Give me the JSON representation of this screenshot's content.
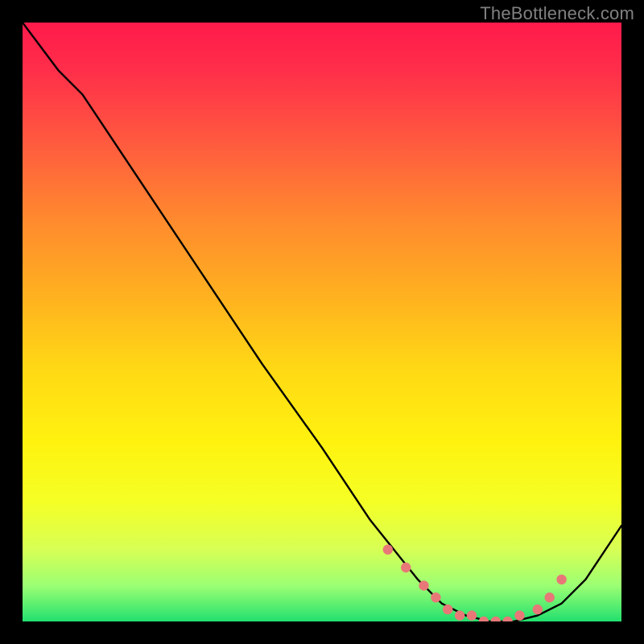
{
  "watermark": "TheBottleneck.com",
  "gradient_colors": {
    "top": "#ff1a4b",
    "mid_upper": "#ff8a2e",
    "mid": "#ffd915",
    "mid_lower": "#f5ff25",
    "bottom": "#22e06e"
  },
  "curve_color": "#000000",
  "marker_color": "#e87878",
  "chart_data": {
    "type": "line",
    "title": "",
    "xlabel": "",
    "ylabel": "",
    "xlim": [
      0,
      100
    ],
    "ylim": [
      0,
      100
    ],
    "grid": false,
    "series": [
      {
        "name": "curve",
        "x": [
          0,
          6,
          10,
          20,
          30,
          40,
          50,
          58,
          62,
          66,
          70,
          74,
          78,
          82,
          86,
          90,
          94,
          100
        ],
        "y": [
          100,
          92,
          88,
          73,
          58,
          43,
          29,
          17,
          12,
          7,
          3,
          1,
          0,
          0,
          1,
          3,
          7,
          16
        ]
      }
    ],
    "markers": {
      "name": "highlighted-points",
      "x": [
        61,
        64,
        67,
        69,
        71,
        73,
        75,
        77,
        79,
        81,
        83,
        86,
        88,
        90
      ],
      "y": [
        12,
        9,
        6,
        4,
        2,
        1,
        1,
        0,
        0,
        0,
        1,
        2,
        4,
        7
      ]
    }
  }
}
